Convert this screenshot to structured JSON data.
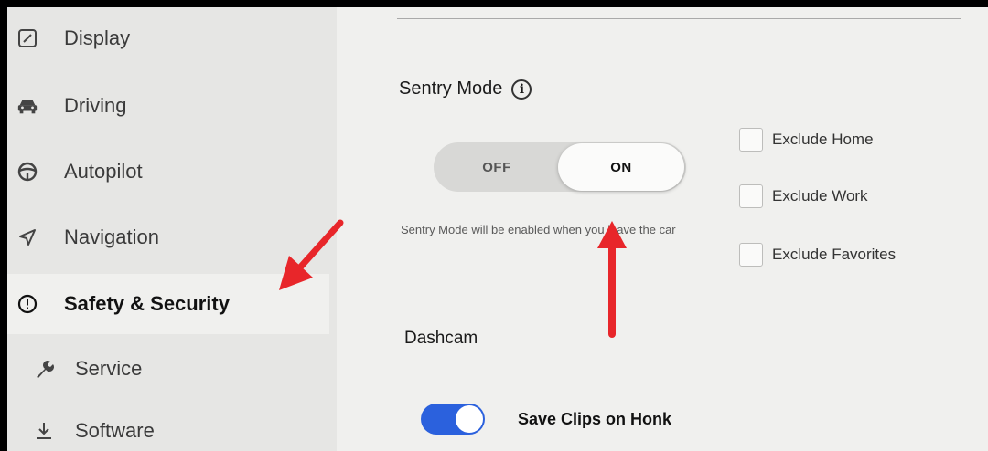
{
  "sidebar": {
    "items": [
      {
        "label": "Display",
        "icon": "display-icon"
      },
      {
        "label": "Driving",
        "icon": "car-icon"
      },
      {
        "label": "Autopilot",
        "icon": "steering-wheel-icon"
      },
      {
        "label": "Navigation",
        "icon": "navigation-arrow-icon"
      },
      {
        "label": "Safety & Security",
        "icon": "alert-circle-icon",
        "active": true
      },
      {
        "label": "Service",
        "icon": "wrench-icon"
      },
      {
        "label": "Software",
        "icon": "download-icon"
      }
    ]
  },
  "sentry": {
    "title": "Sentry Mode",
    "info_icon_text": "i",
    "toggle": {
      "off_label": "OFF",
      "on_label": "ON",
      "selected": "ON"
    },
    "description": "Sentry Mode will be enabled when you leave the car",
    "excludes": [
      {
        "label": "Exclude Home",
        "checked": false
      },
      {
        "label": "Exclude Work",
        "checked": false
      },
      {
        "label": "Exclude Favorites",
        "checked": false
      }
    ]
  },
  "dashcam": {
    "title": "Dashcam",
    "save_clips_on_honk": {
      "label": "Save Clips on Honk",
      "enabled": true
    }
  },
  "colors": {
    "accent_blue": "#2b61dd",
    "annotation_arrow": "#e8262a"
  }
}
